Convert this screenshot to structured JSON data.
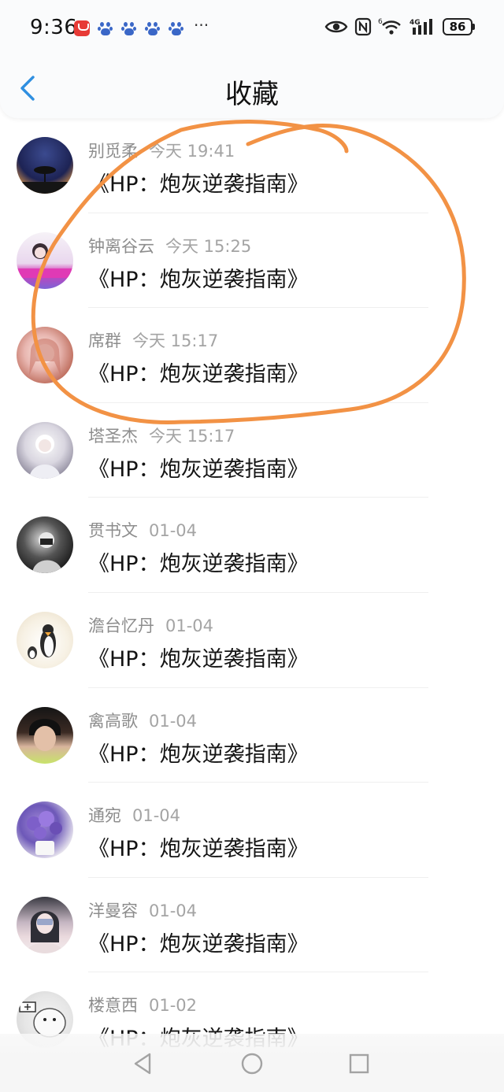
{
  "status_bar": {
    "time": "9:36",
    "more": "···",
    "network": "4G",
    "signal_superscript": "6",
    "battery": "86"
  },
  "header": {
    "title": "收藏",
    "back_icon": "chevron-left-icon"
  },
  "colors": {
    "accent": "#2f8fe0",
    "annotation": "#f29245"
  },
  "favorites": [
    {
      "user": "别觅柔",
      "time": "今天 19:41",
      "book": "《HP：炮灰逆袭指南》"
    },
    {
      "user": "钟离谷云",
      "time": "今天 15:25",
      "book": "《HP：炮灰逆袭指南》"
    },
    {
      "user": "席群",
      "time": "今天 15:17",
      "book": "《HP：炮灰逆袭指南》"
    },
    {
      "user": "塔圣杰",
      "time": "今天 15:17",
      "book": "《HP：炮灰逆袭指南》"
    },
    {
      "user": "贯书文",
      "time": "01-04",
      "book": "《HP：炮灰逆袭指南》"
    },
    {
      "user": "澹台忆丹",
      "time": "01-04",
      "book": "《HP：炮灰逆袭指南》"
    },
    {
      "user": "禽高歌",
      "time": "01-04",
      "book": "《HP：炮灰逆袭指南》"
    },
    {
      "user": "通宛",
      "time": "01-04",
      "book": "《HP：炮灰逆袭指南》"
    },
    {
      "user": "洋曼容",
      "time": "01-04",
      "book": "《HP：炮灰逆袭指南》"
    },
    {
      "user": "楼意西",
      "time": "01-02",
      "book": "《HP：炮灰逆袭指南》"
    }
  ],
  "system_nav": {
    "back_icon": "triangle-back-icon",
    "home_icon": "circle-home-icon",
    "recents_icon": "square-recents-icon"
  }
}
